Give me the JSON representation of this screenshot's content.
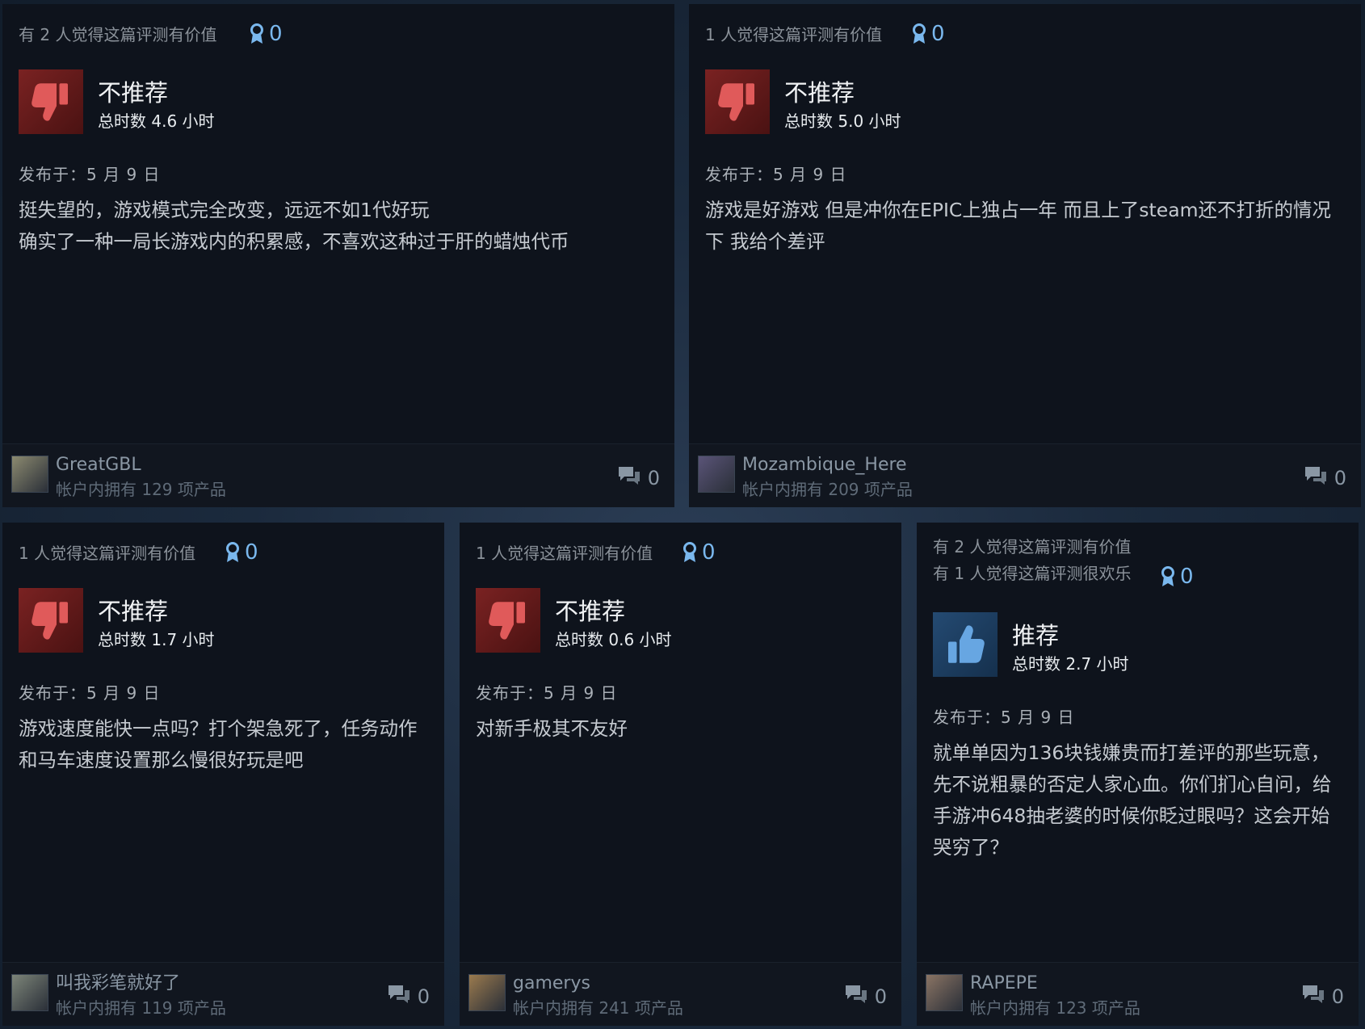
{
  "reviews": [
    {
      "helpful_lines": [
        "有 2 人觉得这篇评测有价值"
      ],
      "awards": "0",
      "verdict": "不推荐",
      "recommended": false,
      "hours": "总时数 4.6 小时",
      "posted": "发布于：5 月 9 日",
      "body": "挺失望的，游戏模式完全改变，远远不如1代好玩\n确实了一种一局长游戏内的积累感，不喜欢这种过于肝的蜡烛代币",
      "user": "GreatGBL",
      "owned": "帐户内拥有 129 项产品",
      "comments": "0",
      "avatar_color": "#8c8a70"
    },
    {
      "helpful_lines": [
        "1 人觉得这篇评测有价值"
      ],
      "awards": "0",
      "verdict": "不推荐",
      "recommended": false,
      "hours": "总时数 5.0 小时",
      "posted": "发布于：5 月 9 日",
      "body": "游戏是好游戏 但是冲你在EPIC上独占一年 而且上了steam还不打折的情况下 我给个差评",
      "user": "Mozambique_Here",
      "owned": "帐户内拥有 209 项产品",
      "comments": "0",
      "avatar_color": "#5a5478"
    },
    {
      "helpful_lines": [
        "1 人觉得这篇评测有价值"
      ],
      "awards": "0",
      "verdict": "不推荐",
      "recommended": false,
      "hours": "总时数 1.7 小时",
      "posted": "发布于：5 月 9 日",
      "body": "游戏速度能快一点吗？打个架急死了，任务动作和马车速度设置那么慢很好玩是吧",
      "user": "叫我彩笔就好了",
      "owned": "帐户内拥有 119 项产品",
      "comments": "0",
      "avatar_color": "#7d8579"
    },
    {
      "helpful_lines": [
        "1 人觉得这篇评测有价值"
      ],
      "awards": "0",
      "verdict": "不推荐",
      "recommended": false,
      "hours": "总时数 0.6 小时",
      "posted": "发布于：5 月 9 日",
      "body": "对新手极其不友好",
      "user": "gamerys",
      "owned": "帐户内拥有 241 项产品",
      "comments": "0",
      "avatar_color": "#9a7a4e"
    },
    {
      "helpful_lines": [
        "有 2 人觉得这篇评测有价值",
        "有 1 人觉得这篇评测很欢乐"
      ],
      "awards": "0",
      "verdict": "推荐",
      "recommended": true,
      "hours": "总时数 2.7 小时",
      "posted": "发布于：5 月 9 日",
      "body": "就单单因为136块钱嫌贵而打差评的那些玩意，先不说粗暴的否定人家心血。你们扪心自问，给手游冲648抽老婆的时候你眨过眼吗？这会开始哭穷了？",
      "user": "RAPEPE",
      "owned": "帐户内拥有 123 项产品",
      "comments": "0",
      "avatar_color": "#8a7464"
    }
  ],
  "colors": {
    "thumb_down": "#e05a5a",
    "thumb_up": "#67a6e2",
    "award": "#7ab8ee"
  },
  "icons": {
    "award": "award-ribbon-icon",
    "thumb_down": "thumbs-down-icon",
    "thumb_up": "thumbs-up-icon",
    "comments": "comment-bubbles-icon"
  }
}
